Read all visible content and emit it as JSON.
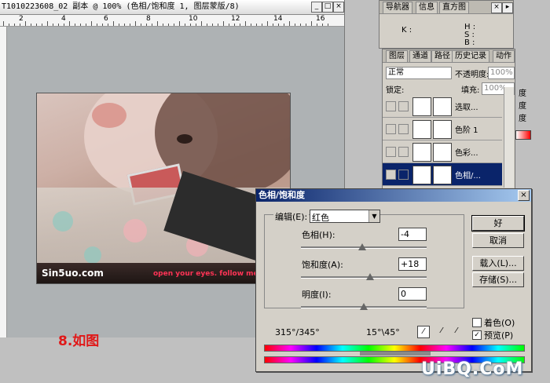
{
  "document": {
    "title": "T1010223608_02 副本 @ 100% (色相/饱和度 1, 图层蒙版/8)",
    "ruler_numbers": [
      "2",
      "4",
      "6",
      "8",
      "10",
      "12",
      "14",
      "16"
    ],
    "watermark_site": "Sin5uo.com",
    "tagline": "open your eyes. follow me."
  },
  "caption": "8.如图",
  "navigator_panel": {
    "tabs": [
      "导航器",
      "信息",
      "直方图"
    ],
    "labels": [
      "K :",
      "H :",
      "S :",
      "B :"
    ]
  },
  "layers_panel": {
    "tabs": [
      "图层",
      "通道",
      "路径",
      "历史记录",
      "动作"
    ],
    "blend_mode": "正常",
    "opacity_label": "不透明度:",
    "opacity_value": "100%",
    "lock_label": "锁定:",
    "fill_label": "填充:",
    "fill_value": "100%",
    "layers": [
      {
        "name": "选取...",
        "selected": false
      },
      {
        "name": "色阶 1",
        "selected": false
      },
      {
        "name": "色彩...",
        "selected": false
      },
      {
        "name": "色相/...",
        "selected": true
      }
    ],
    "side_labels": [
      "度",
      "度",
      "度"
    ]
  },
  "dialog": {
    "title": "色相/饱和度",
    "close": "×",
    "edit_label": "编辑(E):",
    "edit_value": "红色",
    "hue_label": "色相(H):",
    "hue_value": "-4",
    "saturation_label": "饱和度(A):",
    "saturation_value": "+18",
    "lightness_label": "明度(I):",
    "lightness_value": "0",
    "range_left": "315°/345°",
    "range_right": "15°\\45°",
    "ok": "好",
    "cancel": "取消",
    "load": "载入(L)...",
    "save": "存储(S)...",
    "colorize_label": "着色(O)",
    "colorize_checked": false,
    "preview_label": "预览(P)",
    "preview_checked": true,
    "slider_levels": {
      "hue": 0.49,
      "saturation": 0.55,
      "lightness": 0.5
    }
  },
  "watermark": "UiBQ.CoM",
  "colors": {
    "accent": "#0a246a",
    "caption": "#e01818",
    "tagline": "#ff3355"
  }
}
